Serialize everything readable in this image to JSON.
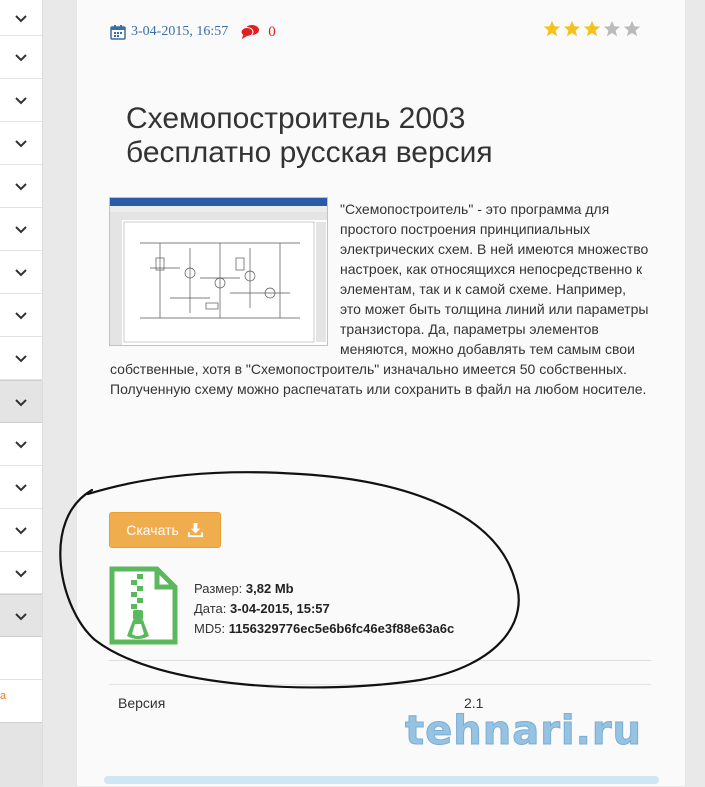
{
  "post": {
    "date": "3-04-2015, 16:57",
    "comments_count": "0",
    "rating": 3,
    "rating_max": 5,
    "title": "Схемопостроитель 2003 бесплатно русская версия",
    "description": "\"Схемопостроитель\" - это программа для простого построения принципиальных электрических схем. В ней имеются множество настроек, как относящихся непосредственно к элементам, так и к самой схеме. Например, это может быть толщина линий или параметры транзистора. Да, параметры элементов меняются, можно добавлять тем самым свои собственные, хотя в \"Схемопостроитель\" изначально имеется 50 собственных. Полученную схему можно распечатать или сохранить в файл на любом носителе."
  },
  "download": {
    "button_label": "Скачать",
    "size_label": "Размер:",
    "size_value": "3,82 Mb",
    "date_label": "Дата:",
    "date_value": "3-04-2015, 15:57",
    "md5_label": "MD5:",
    "md5_value": "1156329776ec5e6b6fc46e3f88e63a6c"
  },
  "table": {
    "rows": [
      {
        "label": "Версия",
        "value": "2.1"
      }
    ]
  },
  "sidebar": {
    "link_text": "а"
  },
  "watermark": "tehnari.ru",
  "colors": {
    "accent_orange": "#f0ad4e",
    "file_icon_green": "#5cb85c",
    "star_gold": "#f4c21b",
    "star_gray": "#bbbbbb",
    "date_blue": "#3b6ea5",
    "comment_red": "#e02020"
  }
}
